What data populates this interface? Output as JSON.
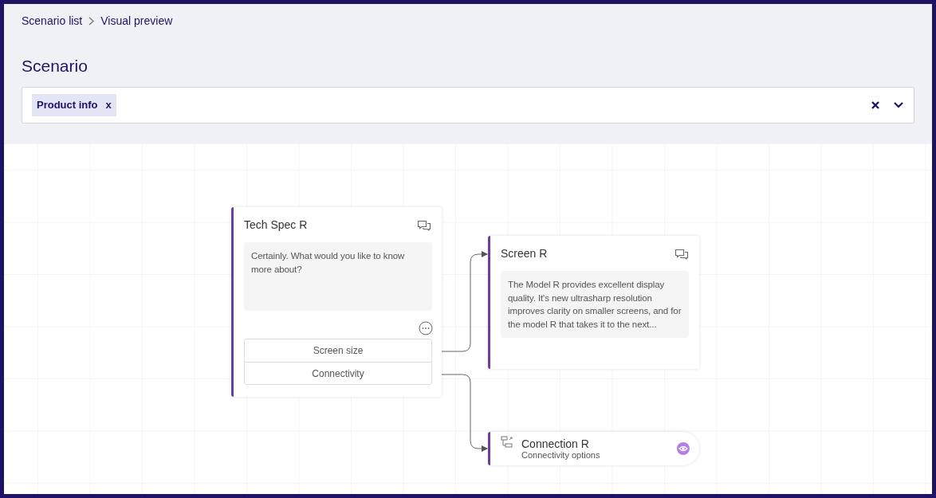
{
  "breadcrumb": [
    {
      "label": "Scenario list"
    },
    {
      "label": "Visual preview"
    }
  ],
  "title": "Scenario",
  "scenario_select": {
    "tags": [
      {
        "label": "Product info",
        "remove": "x"
      }
    ]
  },
  "canvas": {
    "nodes": [
      {
        "kind": "message",
        "title": "Tech Spec R",
        "text": "Certainly. What would you like to know more about?",
        "options": [
          "Screen size",
          "Connectivity"
        ]
      },
      {
        "kind": "message",
        "title": "Screen R",
        "text": "The Model R provides excellent display quality. It's new ultrasharp resolution improves clarity on smaller screens, and for the model R that takes it to the next..."
      },
      {
        "kind": "link",
        "title": "Connection R",
        "subtitle": "Connectivity options"
      }
    ]
  }
}
